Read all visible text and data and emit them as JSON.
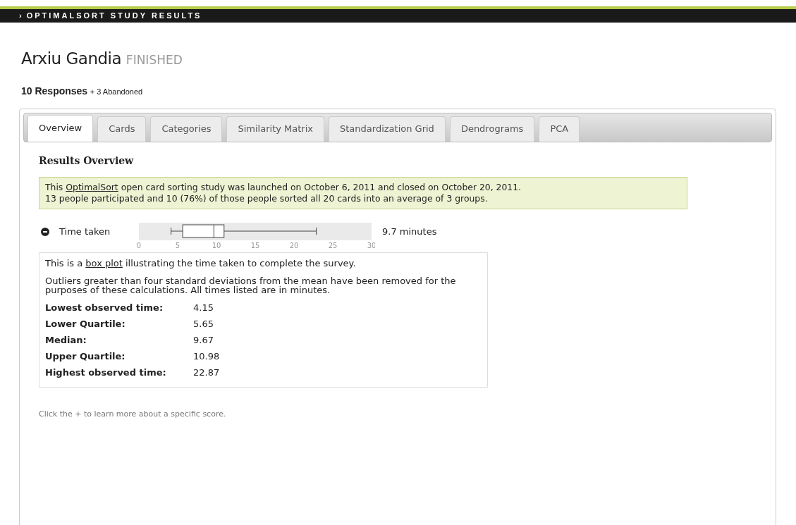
{
  "header": {
    "icon": "›",
    "title": "OPTIMALSORT STUDY RESULTS"
  },
  "study": {
    "name": "Arxiu Gandia",
    "status": "FINISHED"
  },
  "responses": {
    "count": "10 Responses",
    "abandoned": "+ 3 Abandoned"
  },
  "tabs": [
    {
      "label": "Overview",
      "selected": true
    },
    {
      "label": "Cards",
      "selected": false
    },
    {
      "label": "Categories",
      "selected": false
    },
    {
      "label": "Similarity Matrix",
      "selected": false
    },
    {
      "label": "Standardization Grid",
      "selected": false
    },
    {
      "label": "Dendrograms",
      "selected": false
    },
    {
      "label": "PCA",
      "selected": false
    }
  ],
  "section_title": "Results Overview",
  "summary": {
    "before": "This",
    "link": "OptimalSort",
    "after": "open card sorting study was launched on October 6, 2011 and closed on October 20, 2011.",
    "second_line": "13 people participated and 10 (76%) of those people sorted all 20 cards into an average of 3 groups."
  },
  "metric": {
    "label": "Time taken",
    "expanded": true,
    "reading": "9.7 minutes",
    "axis_ticks": [
      "0",
      "5",
      "10",
      "15",
      "20",
      "25",
      "30"
    ]
  },
  "details": {
    "intro": {
      "before": "This is a",
      "link": "box plot",
      "after": "illustrating the time taken to complete the survey."
    },
    "note": "Outliers greater than four standard deviations from the mean have been removed for the purposes of these calculations. All times listed are in minutes.",
    "stats": [
      {
        "label": "Lowest observed time:",
        "value": "4.15"
      },
      {
        "label": "Lower Quartile:",
        "value": "5.65"
      },
      {
        "label": "Median:",
        "value": "9.67"
      },
      {
        "label": "Upper Quartile:",
        "value": "10.98"
      },
      {
        "label": "Highest observed time:",
        "value": "22.87"
      }
    ]
  },
  "footnote": "Click the + to learn more about a specific score."
}
